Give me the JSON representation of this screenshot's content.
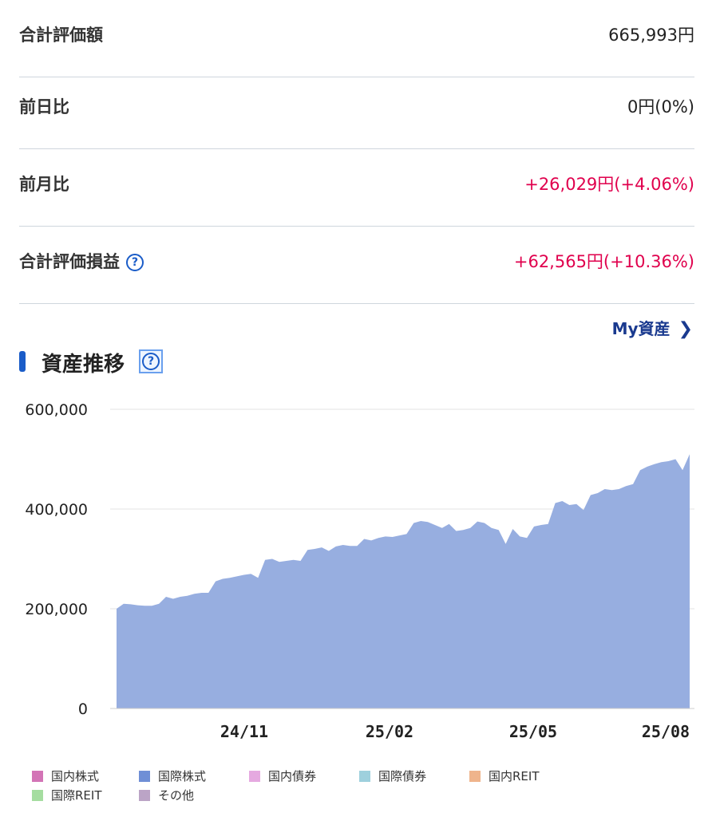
{
  "summary": {
    "total_value": {
      "label": "合計評価額",
      "value": "665,993円"
    },
    "day_change": {
      "label": "前日比",
      "value": "0円(0%)"
    },
    "month_change": {
      "label": "前月比",
      "value": "+26,029円(+4.06%)"
    },
    "total_pl": {
      "label": "合計評価損益",
      "value": "+62,565円(+10.36%)"
    }
  },
  "help_icon_text": "?",
  "my_assets_link": "My資産",
  "section_title": "資産推移",
  "colors": {
    "positive": "#e0004d",
    "accent": "#1a5cc8",
    "area": "#97aee0"
  },
  "chart_data": {
    "type": "area",
    "y_ticks": [
      "0",
      "200,000",
      "400,000",
      "600,000"
    ],
    "ylim": [
      0,
      600000
    ],
    "x_ticks": [
      "24/11",
      "25/02",
      "25/05",
      "25/08"
    ],
    "grid": true,
    "series": [
      {
        "values": [
          200000,
          210000,
          209000,
          207000,
          206000,
          206000,
          210000,
          224000,
          220000,
          224000,
          226000,
          230000,
          232000,
          232000,
          255000,
          260000,
          262000,
          265000,
          268000,
          270000,
          262000,
          298000,
          300000,
          294000,
          296000,
          298000,
          296000,
          318000,
          320000,
          323000,
          316000,
          325000,
          328000,
          326000,
          326000,
          340000,
          337000,
          342000,
          345000,
          344000,
          347000,
          350000,
          372000,
          376000,
          374000,
          368000,
          362000,
          370000,
          356000,
          358000,
          362000,
          375000,
          372000,
          362000,
          358000,
          330000,
          360000,
          345000,
          342000,
          365000,
          368000,
          370000,
          412000,
          416000,
          408000,
          410000,
          398000,
          428000,
          432000,
          440000,
          438000,
          440000,
          446000,
          450000,
          478000,
          485000,
          490000,
          494000,
          496000,
          500000,
          478000,
          510000
        ]
      }
    ],
    "legend": [
      {
        "label": "国内株式",
        "color": "#d374b6"
      },
      {
        "label": "国際株式",
        "color": "#6f8fd6"
      },
      {
        "label": "国内債券",
        "color": "#e5a9e0"
      },
      {
        "label": "国際債券",
        "color": "#9ed0dd"
      },
      {
        "label": "国内REIT",
        "color": "#efb48c"
      },
      {
        "label": "国際REIT",
        "color": "#a5dda0"
      },
      {
        "label": "その他",
        "color": "#bba4c6"
      }
    ]
  }
}
